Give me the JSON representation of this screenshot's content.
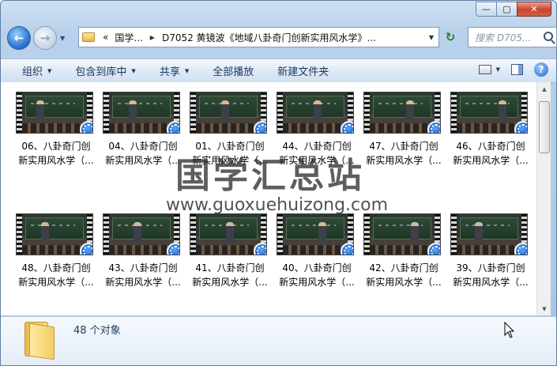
{
  "window": {
    "caption_buttons": {
      "minimize": "—",
      "maximize": "▢",
      "close": "✕"
    }
  },
  "nav": {
    "back_glyph": "←",
    "forward_glyph": "→",
    "address": {
      "prefix": "«",
      "crumb1": "国学...",
      "crumb2": "D7052 黄镜波《地域八卦奇门创新实用风水学》..."
    },
    "search_placeholder": "搜索 D705..."
  },
  "toolbar": {
    "organize": "组织",
    "include_in_library": "包含到库中",
    "share": "共享",
    "play_all": "全部播放",
    "new_folder": "新建文件夹",
    "help_glyph": "?"
  },
  "files": [
    {
      "line1": "06、八卦奇门创",
      "line2": "新实用风水学（..."
    },
    {
      "line1": "04、八卦奇门创",
      "line2": "新实用风水学（..."
    },
    {
      "line1": "01、八卦奇门创",
      "line2": "新实用风水学（..."
    },
    {
      "line1": "44、八卦奇门创",
      "line2": "新实用风水学（..."
    },
    {
      "line1": "47、八卦奇门创",
      "line2": "新实用风水学（..."
    },
    {
      "line1": "46、八卦奇门创",
      "line2": "新实用风水学（..."
    },
    {
      "line1": "48、八卦奇门创",
      "line2": "新实用风水学（..."
    },
    {
      "line1": "43、八卦奇门创",
      "line2": "新实用风水学（..."
    },
    {
      "line1": "41、八卦奇门创",
      "line2": "新实用风水学（..."
    },
    {
      "line1": "40、八卦奇门创",
      "line2": "新实用风水学（..."
    },
    {
      "line1": "42、八卦奇门创",
      "line2": "新实用风水学（..."
    },
    {
      "line1": "39、八卦奇门创",
      "line2": "新实用风水学（..."
    }
  ],
  "watermark": {
    "title": "国学汇总站",
    "url": "www.guoxuehuizong.com"
  },
  "details": {
    "count_text": "48 个对象"
  },
  "colors": {
    "accent": "#1e395b",
    "badge": "#1357c2",
    "close": "#c7452a"
  }
}
